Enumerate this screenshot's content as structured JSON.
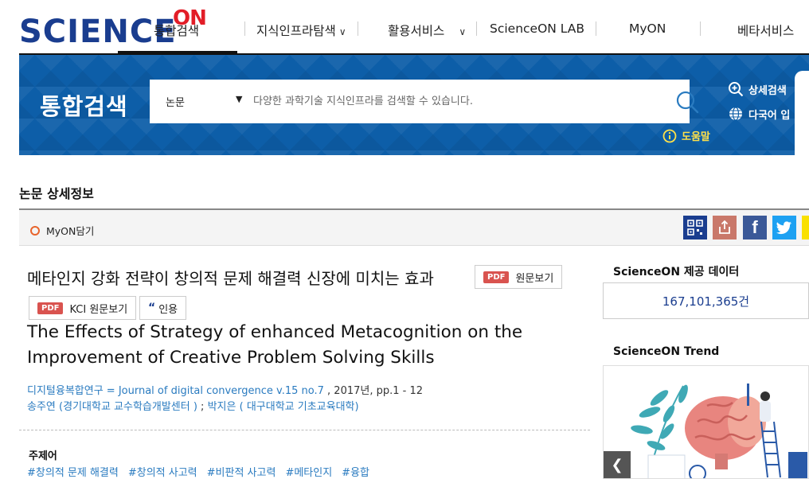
{
  "header": {
    "logo_main": "SCIENCE",
    "logo_on": "ON",
    "menu": [
      {
        "label": "통합검색",
        "active": true,
        "has_dropdown": false
      },
      {
        "label": "지식인프라탐색",
        "active": false,
        "has_dropdown": true
      },
      {
        "label": "활용서비스",
        "active": false,
        "has_dropdown": true
      },
      {
        "label": "ScienceON LAB",
        "active": false,
        "has_dropdown": false
      },
      {
        "label": "MyON",
        "active": false,
        "has_dropdown": false
      },
      {
        "label": "베타서비스",
        "active": false,
        "has_dropdown": false
      }
    ]
  },
  "search": {
    "title": "통합검색",
    "category": "논문",
    "placeholder": "다양한 과학기술 지식인프라를 검색할 수 있습니다.",
    "advanced_label": "상세검색",
    "multilang_label": "다국어 입",
    "help_label": "도움말"
  },
  "page": {
    "section_title": "논문 상세정보",
    "myon_label": "MyON담기"
  },
  "share": [
    "qr-code-icon",
    "export-icon",
    "facebook-icon",
    "twitter-icon",
    "kakao-icon"
  ],
  "article": {
    "title_kr": "메타인지 강화 전략이 창의적 문제 해결력 신장에 미치는 효과",
    "pdf_tag": "PDF",
    "original_label": "원문보기",
    "kci_label": "KCI 원문보기",
    "cite_label": "인용",
    "title_en": "The Effects of Strategy of enhanced Metacognition on the Improvement of Creative Problem Solving Skills",
    "journal_link": "디지털융복합연구 = Journal of digital convergence v.15 no.7",
    "journal_rest": " , 2017년, pp.1 - 12",
    "author1": "송주연",
    "author1_aff": "(경기대학교 교수학습개발센터 )",
    "author_sep": " ;  ",
    "author2": "박지은",
    "author2_aff": "( 대구대학교 기초교육대학)",
    "keywords_title": "주제어",
    "keywords": [
      "#창의적 문제 해결력",
      "#창의적 사고력",
      "#비판적 사고력",
      "#메타인지",
      "#융합"
    ]
  },
  "right_panel": {
    "data_title": "ScienceON 제공 데이터",
    "data_count": "167,101,365건",
    "trend_title": "ScienceON Trend"
  },
  "colors": {
    "brand_blue": "#1a3d8f",
    "banner_blue": "#0d5ea8",
    "brand_red": "#e21d27",
    "link_blue": "#2a7bc0",
    "help_yellow": "#ffe14a"
  }
}
